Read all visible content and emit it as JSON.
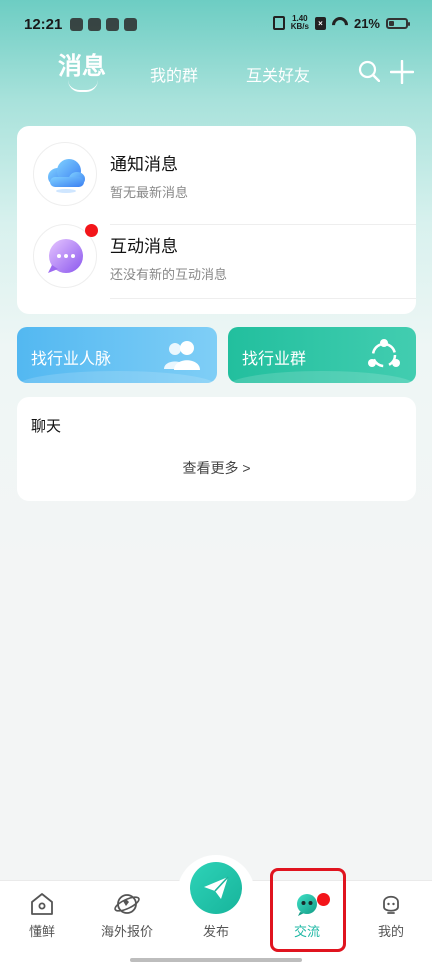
{
  "status": {
    "time": "12:21",
    "net_speed_top": "1.40",
    "net_speed_bottom": "KB/s",
    "battery": "21%"
  },
  "header": {
    "tabs": [
      {
        "label": "消息",
        "active": true
      },
      {
        "label": "我的群"
      },
      {
        "label": "互关好友"
      }
    ],
    "icons": [
      "search-icon",
      "plus-icon"
    ]
  },
  "messages": [
    {
      "title": "通知消息",
      "subtitle": "暂无最新消息",
      "icon": "cloud-icon",
      "unread": false
    },
    {
      "title": "互动消息",
      "subtitle": "还没有新的互动消息",
      "icon": "chat-bubble-icon",
      "unread": true
    }
  ],
  "features": [
    {
      "label": "找行业人脉",
      "icon": "people-icon",
      "color": "#53b8f1"
    },
    {
      "label": "找行业群",
      "icon": "share-network-icon",
      "color": "#22bf9e"
    }
  ],
  "chat": {
    "title": "聊天",
    "more": "查看更多 >"
  },
  "bottom_nav": {
    "items": [
      {
        "label": "懂鲜",
        "icon": "home-icon"
      },
      {
        "label": "海外报价",
        "icon": "globe-icon"
      },
      {
        "label": "发布",
        "icon": "paper-plane-icon"
      },
      {
        "label": "交流",
        "icon": "chat-face-icon",
        "active": true,
        "badge": true
      },
      {
        "label": "我的",
        "icon": "user-icon"
      }
    ]
  },
  "colors": {
    "accent": "#1fb8a5",
    "badge": "#f3151a",
    "highlight": "#e0141f"
  }
}
